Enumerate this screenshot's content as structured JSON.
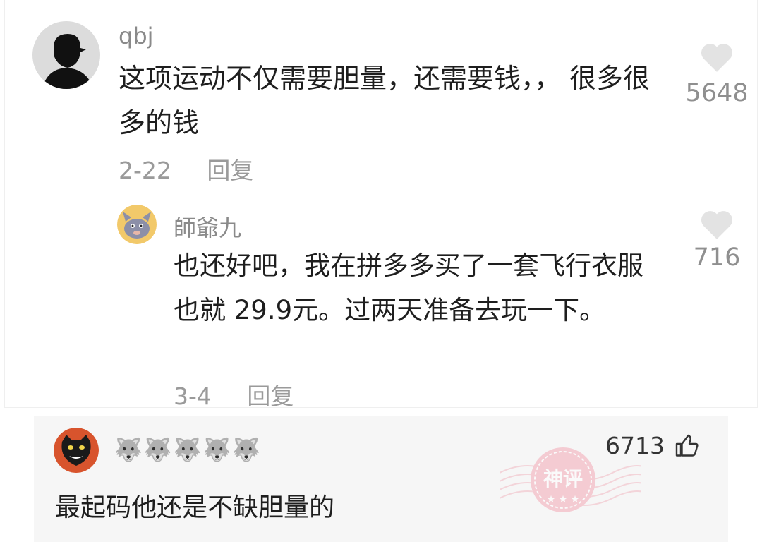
{
  "comment": {
    "username": "qbj",
    "text": "这项运动不仅需要胆量，还需要钱，， 很多很多的钱",
    "date": "2-22",
    "reply_label": "回复",
    "likes": "5648"
  },
  "reply": {
    "username": "師爺九",
    "text": "也还好吧，我在拼多多买了一套飞行衣服也就 29.9元。过两天准备去玩一下。",
    "date": "3-4",
    "reply_label": "回复",
    "likes": "716"
  },
  "god_comment": {
    "username": "🐺🐺🐺🐺🐺",
    "likes": "6713",
    "text": "最起码他还是不缺胆量的",
    "stamp_text": "神评",
    "stamp_color": "#e9889a"
  }
}
